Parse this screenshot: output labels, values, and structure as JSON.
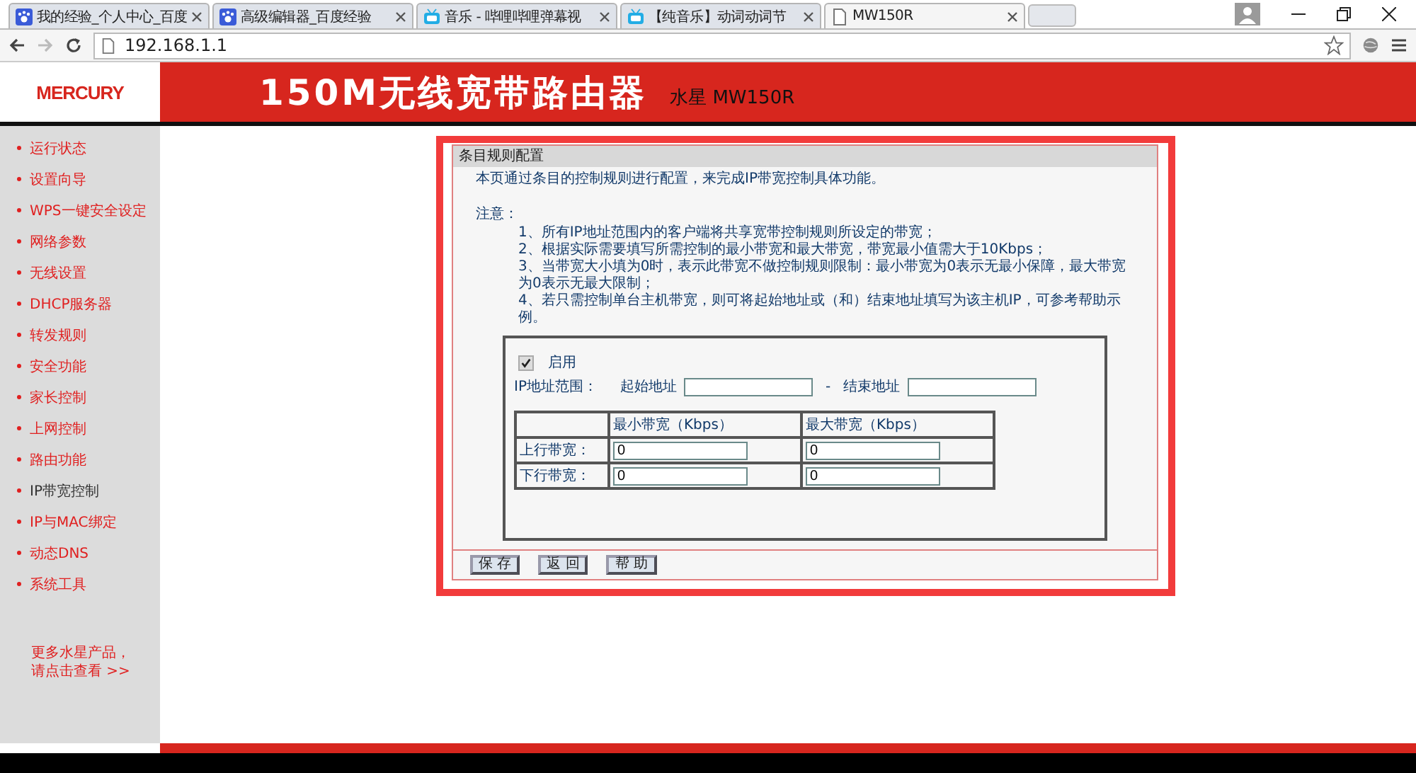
{
  "browser": {
    "tabs": [
      {
        "title": "我的经验_个人中心_百度",
        "selected": false
      },
      {
        "title": "高级编辑器_百度经验",
        "selected": false
      },
      {
        "title": "音乐 - 哔哩哔哩弹幕视",
        "selected": false
      },
      {
        "title": "【纯音乐】动词动词节",
        "selected": false
      },
      {
        "title": "MW150R",
        "selected": true
      }
    ],
    "address": "192.168.1.1"
  },
  "header": {
    "logo": "MERCURY",
    "title": "150M无线宽带路由器",
    "model": "水星 MW150R"
  },
  "sidebar": {
    "items": [
      {
        "label": "运行状态",
        "selected": false
      },
      {
        "label": "设置向导",
        "selected": false
      },
      {
        "label": "WPS一键安全设定",
        "selected": false
      },
      {
        "label": "网络参数",
        "selected": false
      },
      {
        "label": "无线设置",
        "selected": false
      },
      {
        "label": "DHCP服务器",
        "selected": false
      },
      {
        "label": "转发规则",
        "selected": false
      },
      {
        "label": "安全功能",
        "selected": false
      },
      {
        "label": "家长控制",
        "selected": false
      },
      {
        "label": "上网控制",
        "selected": false
      },
      {
        "label": "路由功能",
        "selected": false
      },
      {
        "label": "IP带宽控制",
        "selected": true
      },
      {
        "label": "IP与MAC绑定",
        "selected": false
      },
      {
        "label": "动态DNS",
        "selected": false
      },
      {
        "label": "系统工具",
        "selected": false
      }
    ],
    "more": [
      "更多水星产品，",
      "请点击查看 >>"
    ]
  },
  "panel": {
    "title": "条目规则配置",
    "intro": "本页通过条目的控制规则进行配置，来完成IP带宽控制具体功能。",
    "notes_label": "注意：",
    "notes": [
      "1、所有IP地址范围内的客户端将共享宽带控制规则所设定的带宽；",
      "2、根据实际需要填写所需控制的最小带宽和最大带宽，带宽最小值需大于10Kbps；",
      "3、当带宽大小填为0时，表示此带宽不做控制规则限制：最小带宽为0表示无最小保障，最大带宽为0表示无最大限制；",
      "4、若只需控制单台主机带宽，则可将起始地址或（和）结束地址填写为该主机IP，可参考帮助示例。"
    ],
    "enable": {
      "label": "启用",
      "checked": true
    },
    "range": {
      "label": "IP地址范围：",
      "start_label": "起始地址",
      "dash": "-",
      "end_label": "结束地址"
    },
    "table": {
      "columns": [
        "最小带宽（Kbps）",
        "最大带宽（Kbps）"
      ],
      "rows": [
        {
          "label": "上行带宽：",
          "min": "0",
          "max": "0"
        },
        {
          "label": "下行带宽：",
          "min": "0",
          "max": "0"
        }
      ]
    },
    "buttons": [
      "保 存",
      "返 回",
      "帮 助"
    ]
  }
}
